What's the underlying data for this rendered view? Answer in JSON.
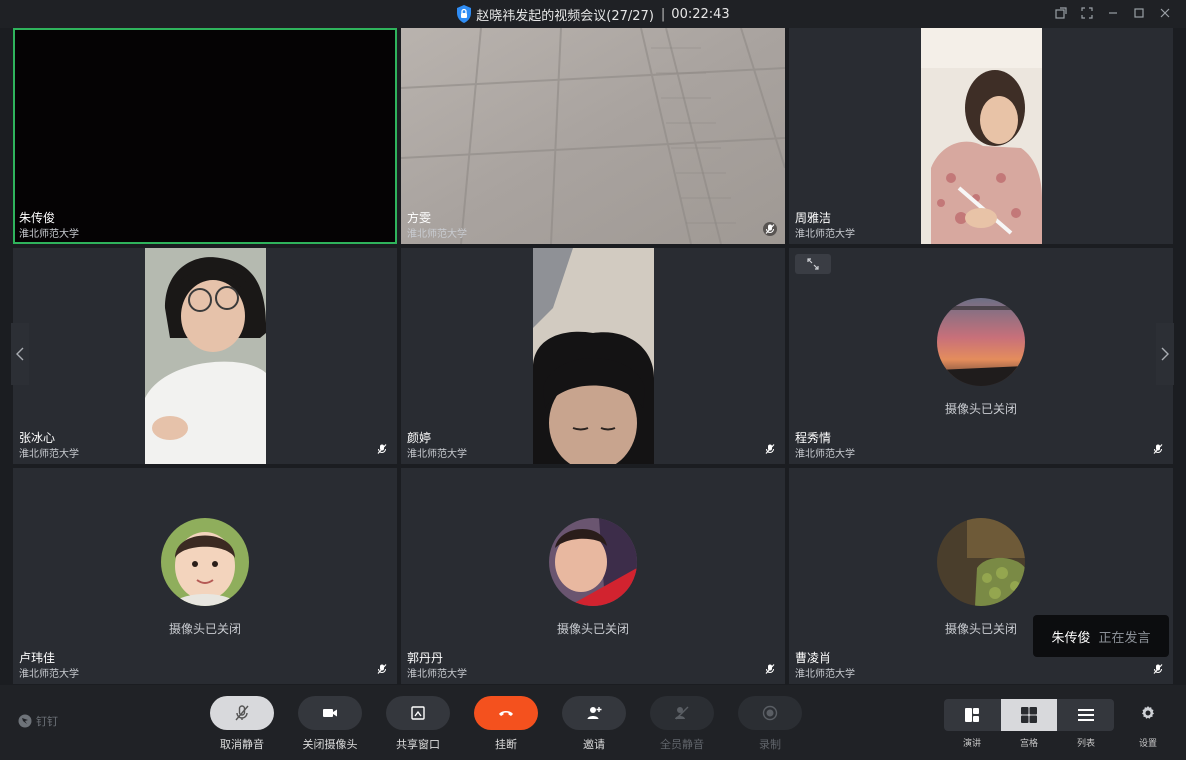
{
  "window": {
    "title": "赵晓祎发起的视频会议(27/27)",
    "sep": "|",
    "timer": "00:22:43"
  },
  "tiles": [
    {
      "name": "朱传俊",
      "org": "淮北师范大学",
      "active": true,
      "type": "video-dark"
    },
    {
      "name": "方雯",
      "org": "淮北师范大学",
      "type": "video-floor",
      "muted": true
    },
    {
      "name": "周雅洁",
      "org": "淮北师范大学",
      "type": "video-portrait"
    },
    {
      "name": "张冰心",
      "org": "淮北师范大学",
      "type": "video-portrait",
      "muted": true
    },
    {
      "name": "颜婷",
      "org": "淮北师范大学",
      "type": "video-portrait",
      "muted": true
    },
    {
      "name": "程秀情",
      "org": "淮北师范大学",
      "type": "camera-off",
      "cam_off_text": "摄像头已关闭",
      "muted": true
    },
    {
      "name": "卢玮佳",
      "org": "淮北师范大学",
      "type": "camera-off",
      "cam_off_text": "摄像头已关闭",
      "muted": true
    },
    {
      "name": "郭丹丹",
      "org": "淮北师范大学",
      "type": "camera-off",
      "cam_off_text": "摄像头已关闭",
      "muted": true
    },
    {
      "name": "曹凌肖",
      "org": "淮北师范大学",
      "type": "camera-off",
      "cam_off_text": "摄像头已关闭",
      "muted": true
    }
  ],
  "speaker_toast": {
    "name": "朱传俊",
    "status": "正在发言"
  },
  "brand": "钉钉",
  "toolbar": {
    "unmute": "取消静音",
    "camera_off": "关闭摄像头",
    "share": "共享窗口",
    "hangup": "挂断",
    "invite": "邀请",
    "mute_all": "全员静音",
    "record": "录制"
  },
  "layouts": {
    "speaker": "演讲",
    "grid": "宫格",
    "list": "列表"
  },
  "settings": "设置",
  "colors": {
    "active_border": "#2fb35c",
    "hangup": "#f4511e",
    "tile_bg": "#292c32"
  }
}
